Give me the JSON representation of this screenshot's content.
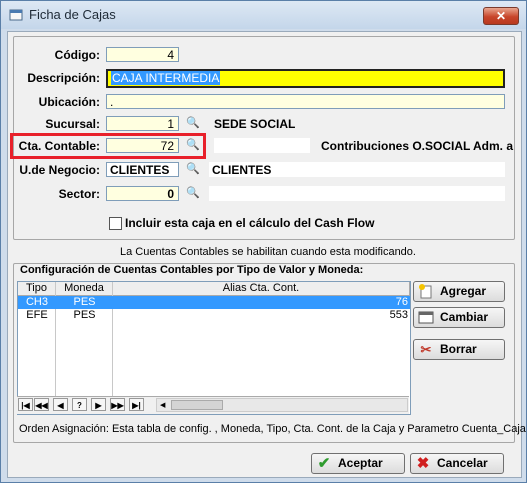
{
  "window": {
    "title": "Ficha de Cajas",
    "close_glyph": "✕"
  },
  "form": {
    "codigo": {
      "label": "Código:",
      "value": "4"
    },
    "descripcion": {
      "label": "Descripción:",
      "value": "CAJA INTERMEDIA"
    },
    "ubicacion": {
      "label": "Ubicación:",
      "value": "."
    },
    "sucursal": {
      "label": "Sucursal:",
      "value": "1",
      "desc": "SEDE SOCIAL"
    },
    "cta_contable": {
      "label": "Cta. Contable:",
      "value": "72",
      "desc": "Contribuciones O.SOCIAL Adm. a"
    },
    "u_negocio": {
      "label": "U.de Negocio:",
      "value": "CLIENTES",
      "desc": "CLIENTES"
    },
    "sector": {
      "label": "Sector:",
      "value": "0"
    },
    "cash_flow_checkbox": {
      "label": "Incluir esta caja en el cálculo del Cash Flow",
      "checked": false
    }
  },
  "info_note": "La Cuentas Contables se habilitan cuando esta modificando.",
  "config": {
    "title": "Configuración de Cuentas Contables por Tipo de Valor y Moneda:",
    "columns": [
      "Tipo",
      "Moneda",
      "Alias Cta. Cont."
    ],
    "rows": [
      {
        "tipo": "CH3",
        "moneda": "PES",
        "alias": "76",
        "selected": true
      },
      {
        "tipo": "EFE",
        "moneda": "PES",
        "alias": "553",
        "selected": false
      }
    ],
    "nav": [
      "|◀",
      "◀◀",
      "◀",
      "?",
      "▶",
      "▶▶",
      "▶|"
    ],
    "buttons": {
      "agregar": "Agregar",
      "cambiar": "Cambiar",
      "borrar": "Borrar"
    },
    "footer": "Orden Asignación: Esta tabla de config. , Moneda, Tipo, Cta. Cont. de la Caja y Parametro Cuenta_Caja"
  },
  "actions": {
    "aceptar": "Aceptar",
    "cancelar": "Cancelar"
  },
  "colors": {
    "highlight_box": "#e8202a",
    "selected_row": "#3399ff",
    "field_yellow": "#ffffe0"
  }
}
